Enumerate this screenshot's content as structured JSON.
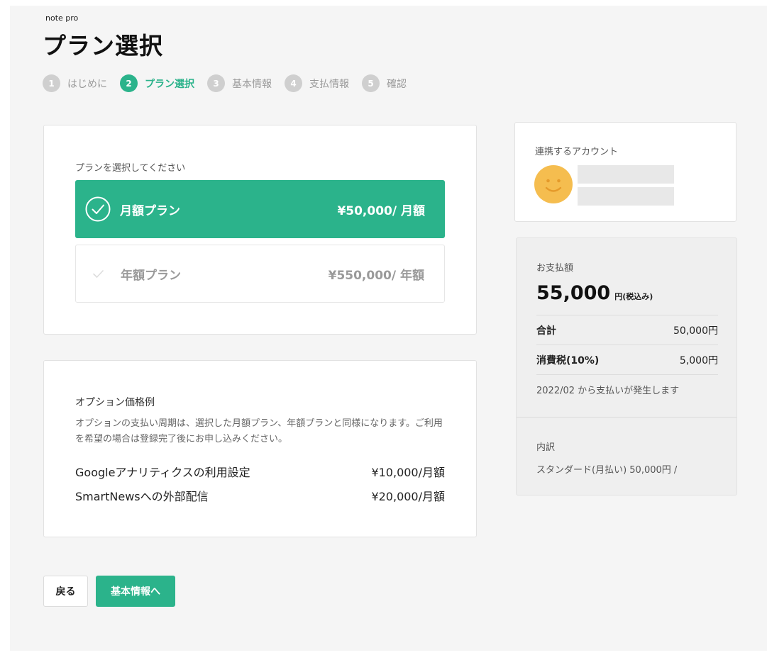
{
  "header": {
    "brand": "note pro",
    "title": "プラン選択"
  },
  "steps": [
    {
      "num": "1",
      "label": "はじめに",
      "active": false
    },
    {
      "num": "2",
      "label": "プラン選択",
      "active": true
    },
    {
      "num": "3",
      "label": "基本情報",
      "active": false
    },
    {
      "num": "4",
      "label": "支払情報",
      "active": false
    },
    {
      "num": "5",
      "label": "確認",
      "active": false
    }
  ],
  "plans": {
    "heading": "プランを選択してください",
    "monthly": {
      "name": "月額プラン",
      "price": "¥50,000/ 月額",
      "selected": true
    },
    "yearly": {
      "name": "年額プラン",
      "price": "¥550,000/ 年額",
      "selected": false
    }
  },
  "options": {
    "title": "オプション価格例",
    "description": "オプションの支払い周期は、選択した月額プラン、年額プランと同様になります。ご利用を希望の場合は登録完了後にお申し込みください。",
    "items": [
      {
        "name": "Googleアナリティクスの利用設定",
        "price": "¥10,000/月額"
      },
      {
        "name": "SmartNewsへの外部配信",
        "price": "¥20,000/月額"
      }
    ]
  },
  "account": {
    "title": "連携するアカウント",
    "avatar_icon": "smiley-face-icon"
  },
  "payment": {
    "label": "お支払額",
    "total": "55,000",
    "unit": "円(税込み)",
    "subtotal_label": "合計",
    "subtotal_value": "50,000円",
    "tax_label": "消費税(10%)",
    "tax_value": "5,000円",
    "note": "2022/02 から支払いが発生します",
    "breakdown_label": "内訳",
    "breakdown_text": "スタンダード(月払い) 50,000円 /"
  },
  "actions": {
    "back_label": "戻る",
    "next_label": "基本情報へ"
  },
  "colors": {
    "accent": "#2bb38b",
    "avatar": "#f5bd4f"
  }
}
